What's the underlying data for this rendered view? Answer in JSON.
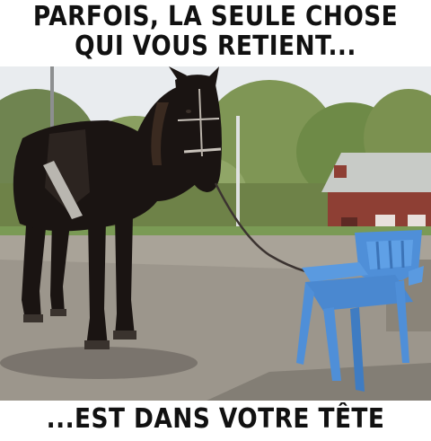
{
  "meme": {
    "top_caption_line1": "PARFOIS, LA SEULE CHOSE",
    "top_caption_line2": "QUI VOUS RETIENT...",
    "bottom_caption": "...EST DANS VOTRE TÊTE"
  },
  "colors": {
    "horse": "#1a1412",
    "chair": "#4f8fd8",
    "pavement": "#9c968c",
    "sky": "#e9ecef",
    "trees": "#7a8f52",
    "building_roof": "#c8cbc7",
    "building_wall": "#8e3f34"
  }
}
